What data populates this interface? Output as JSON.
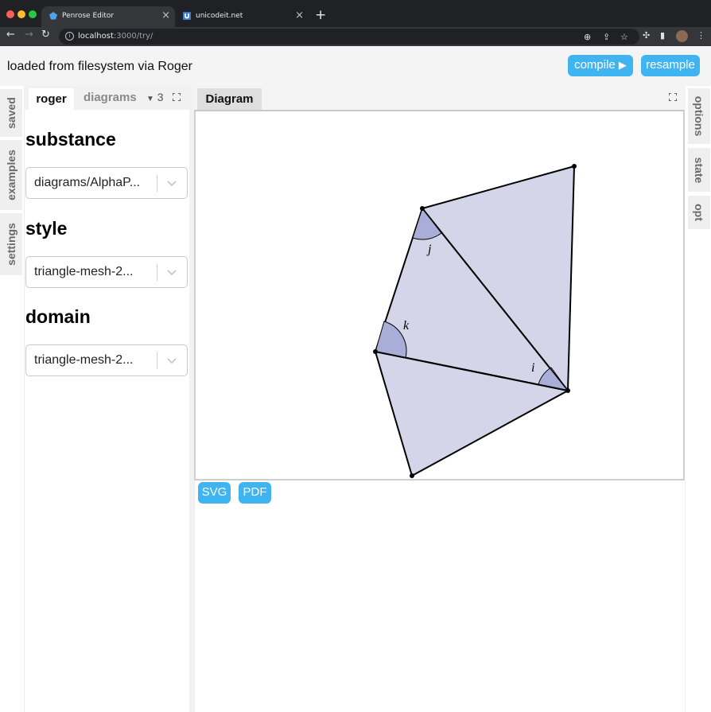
{
  "browser": {
    "tabs": [
      {
        "title": "Penrose Editor",
        "icon": "penrose-icon"
      },
      {
        "title": "unicodeit.net",
        "icon": "unicodeit-icon"
      }
    ],
    "close_glyph": "×",
    "new_tab_glyph": "+",
    "url_host": "localhost",
    "url_rest": ":3000/try/"
  },
  "header": {
    "title": "loaded from filesystem via Roger",
    "compile_label": "compile",
    "resample_label": "resample"
  },
  "left_vtabs": [
    "saved",
    "examples",
    "settings"
  ],
  "right_vtabs": [
    "options",
    "state",
    "opt"
  ],
  "left_panel": {
    "tabs": {
      "active": "roger",
      "other": "diagrams",
      "count": "3"
    },
    "sections": [
      {
        "heading": "substance",
        "value": "diagrams/AlphaP..."
      },
      {
        "heading": "style",
        "value": "triangle-mesh-2..."
      },
      {
        "heading": "domain",
        "value": "triangle-mesh-2..."
      }
    ]
  },
  "diagram_panel": {
    "tab_label": "Diagram",
    "export_buttons": [
      "SVG",
      "PDF"
    ],
    "angle_labels": {
      "j": "j",
      "k": "k",
      "i": "i"
    }
  },
  "colors": {
    "accent": "#40b4f0",
    "face_fill": "#d4d5e8",
    "angle_fill": "#a9aed8",
    "chrome_dark": "#202124"
  }
}
